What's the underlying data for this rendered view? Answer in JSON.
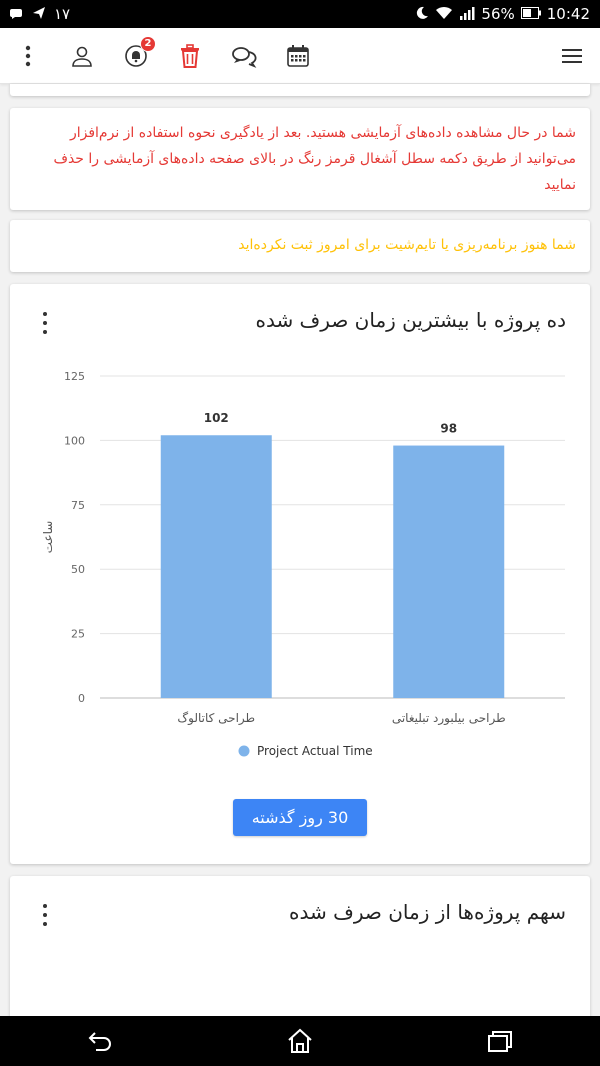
{
  "status_bar": {
    "left_number": "۱۷",
    "battery": "56%",
    "time": "10:42"
  },
  "app_bar": {
    "notification_badge": "2",
    "icons": [
      "kebab-menu-icon",
      "user-icon",
      "bell-icon",
      "trash-icon",
      "chat-icon",
      "calendar-icon",
      "hamburger-menu-icon"
    ]
  },
  "alerts": {
    "demo_data": "شما در حال مشاهده داده‌های آزمایشی هستید. بعد از یادگیری نحوه استفاده از نرم‌افزار می‌توانید از طریق دکمه سطل آشغال قرمز رنگ در بالای صفحه داده‌های آزمایشی را حذف نمایید",
    "no_timesheet": "شما هنوز برنامه‌ریزی یا تایم‌شیت برای امروز ثبت نکرده‌اید"
  },
  "chart_card": {
    "title": "ده پروژه با بیشترین زمان صرف شده",
    "range_button": "30 روز گذشته"
  },
  "share_card": {
    "title": "سهم پروژه‌ها از زمان صرف شده"
  },
  "colors": {
    "alert_red": "#e53935",
    "alert_yellow": "#ffc107",
    "bar": "#7eb3ea",
    "button": "#3d85f5"
  },
  "chart_data": {
    "type": "bar",
    "categories": [
      "طراحی کاتالوگ",
      "طراحی بیلبورد تبلیغاتی"
    ],
    "series": [
      {
        "name": "Project Actual Time",
        "values": [
          102,
          98
        ]
      }
    ],
    "data_labels": [
      "102",
      "98"
    ],
    "ylabel": "ساعت",
    "ylim": [
      0,
      125
    ],
    "yticks": [
      "0",
      "25",
      "50",
      "75",
      "100",
      "125"
    ],
    "grid": true,
    "legend": "bottom"
  }
}
